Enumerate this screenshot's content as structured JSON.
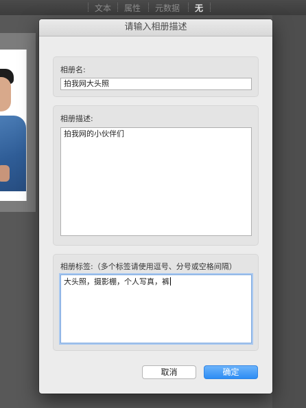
{
  "app": {
    "tabs": [
      {
        "label": "文本"
      },
      {
        "label": "属性"
      },
      {
        "label": "元数据"
      },
      {
        "label": "无"
      }
    ]
  },
  "dialog": {
    "title": "请输入相册描述",
    "name": {
      "label": "相册名:",
      "value": "拍我网大头照"
    },
    "description": {
      "label": "相册描述:",
      "value": "拍我网的小伙伴们"
    },
    "tags": {
      "label": "相册标签:",
      "hint": "（多个标签请使用逗号、分号或空格间隔）",
      "value": "大头照，摄影棚，个人写真，裤"
    },
    "cancel_label": "取消",
    "ok_label": "确定"
  },
  "colors": {
    "accent": "#2d8df4",
    "focus_ring": "#a9c8f0",
    "dialog_bg": "#ececec"
  }
}
